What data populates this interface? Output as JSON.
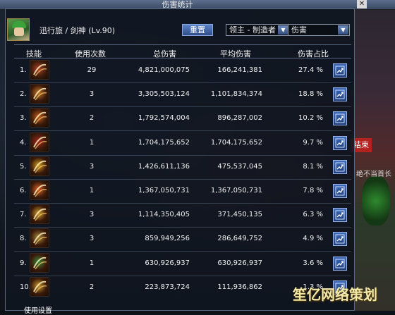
{
  "window": {
    "title": "伤害统计"
  },
  "character": {
    "name": "迅行旅 / 剑神 (Lv.90)"
  },
  "controls": {
    "reset_label": "重置",
    "target_select": "领主 - 制造者",
    "type_select": "伤害"
  },
  "table": {
    "headers": [
      "技能",
      "使用次数",
      "总伤害",
      "平均伤害",
      "伤害占比"
    ],
    "rows": [
      {
        "idx": "1.",
        "uses": "29",
        "total": "4,821,000,075",
        "avg": "166,241,381",
        "pct": "27.4 %",
        "icon": "triple-slash-skill-icon",
        "color": "#b0442a"
      },
      {
        "idx": "2.",
        "uses": "3",
        "total": "3,305,503,124",
        "avg": "1,101,834,374",
        "pct": "18.8 %",
        "icon": "sword-cross-skill-icon",
        "color": "#c87a2a"
      },
      {
        "idx": "3.",
        "uses": "2",
        "total": "1,792,574,004",
        "avg": "896,287,002",
        "pct": "10.2 %",
        "icon": "spiral-slash-skill-icon",
        "color": "#c25c1c"
      },
      {
        "idx": "4.",
        "uses": "1",
        "total": "1,704,175,652",
        "avg": "1,704,175,652",
        "pct": "9.7 %",
        "icon": "burst-skill-icon",
        "color": "#a6261e"
      },
      {
        "idx": "5.",
        "uses": "3",
        "total": "1,426,611,136",
        "avg": "475,537,045",
        "pct": "8.1 %",
        "icon": "crescent-skill-icon",
        "color": "#d6a222"
      },
      {
        "idx": "6.",
        "uses": "1",
        "total": "1,367,050,731",
        "avg": "1,367,050,731",
        "pct": "7.8 %",
        "icon": "flame-fan-skill-icon",
        "color": "#d8622a"
      },
      {
        "idx": "7.",
        "uses": "3",
        "total": "1,114,350,405",
        "avg": "371,450,135",
        "pct": "6.3 %",
        "icon": "wave-slash-skill-icon",
        "color": "#d2a030"
      },
      {
        "idx": "8.",
        "uses": "3",
        "total": "859,949,256",
        "avg": "286,649,752",
        "pct": "4.9 %",
        "icon": "blade-rush-skill-icon",
        "color": "#a88a3a"
      },
      {
        "idx": "9.",
        "uses": "1",
        "total": "630,926,937",
        "avg": "630,926,937",
        "pct": "3.6 %",
        "icon": "green-glyph-skill-icon",
        "color": "#3a8a3a"
      },
      {
        "idx": "10.",
        "uses": "2",
        "total": "223,873,724",
        "avg": "111,936,862",
        "pct": "1.3 %",
        "icon": "golden-arc-skill-icon",
        "color": "#c89a30"
      }
    ]
  },
  "footer": {
    "label": "使用设置"
  },
  "side": {
    "badge": "结束",
    "text": "绝不当首长"
  },
  "watermark": "笙亿网络策划"
}
